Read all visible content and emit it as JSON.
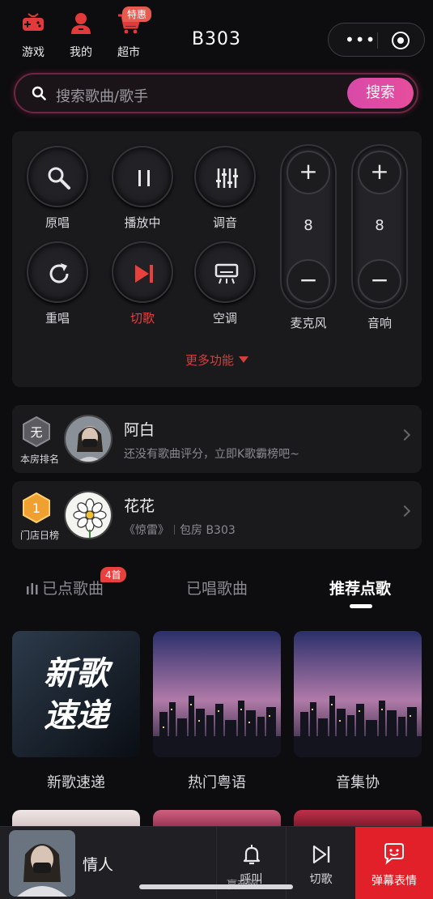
{
  "header": {
    "items": [
      {
        "label": "游戏",
        "icon": "gamepad-icon"
      },
      {
        "label": "我的",
        "icon": "user-icon"
      },
      {
        "label": "超市",
        "icon": "cart-icon",
        "badge": "特惠"
      }
    ],
    "room": "B303",
    "capsule": {
      "more_icon": "more-dots-icon",
      "close_icon": "target-icon"
    }
  },
  "search": {
    "placeholder": "搜索歌曲/歌手",
    "button": "搜索"
  },
  "controls": {
    "buttons": [
      {
        "label": "原唱",
        "icon": "search-mic-icon"
      },
      {
        "label": "播放中",
        "icon": "pause-icon"
      },
      {
        "label": "调音",
        "icon": "equalizer-icon"
      },
      {
        "label": "重唱",
        "icon": "replay-icon"
      },
      {
        "label": "切歌",
        "icon": "next-track-icon",
        "accent": "#e8403c"
      },
      {
        "label": "空调",
        "icon": "air-conditioner-icon"
      }
    ],
    "mic": {
      "label": "麦克风",
      "value": "8",
      "plus": "+",
      "minus": "−"
    },
    "speaker": {
      "label": "音响",
      "value": "8",
      "plus": "+",
      "minus": "−"
    },
    "more": "更多功能"
  },
  "rank_cards": [
    {
      "badge": "无",
      "caption": "本房排名",
      "name": "阿白",
      "sub": "还没有歌曲评分，立即K歌霸榜吧~"
    },
    {
      "badge": "1",
      "caption": "门店日榜",
      "name": "花花",
      "song": "《惊雷》",
      "room": "包房 B303"
    }
  ],
  "tabs": [
    {
      "label": "已点歌曲",
      "badge": "4首"
    },
    {
      "label": "已唱歌曲"
    },
    {
      "label": "推荐点歌",
      "active": true
    }
  ],
  "recommend": [
    {
      "label": "新歌速递",
      "cover_text_1": "新歌",
      "cover_text_2": "速递"
    },
    {
      "label": "热门粤语"
    },
    {
      "label": "音集协"
    }
  ],
  "player": {
    "song": "情人",
    "call": "呼叫",
    "skip": "切歌",
    "danmu": "弹幕表情"
  },
  "watermark": "赢商网",
  "colors": {
    "accent_red": "#e8403c",
    "search_pink": "#e64d9c",
    "background": "#0d0d0f"
  }
}
